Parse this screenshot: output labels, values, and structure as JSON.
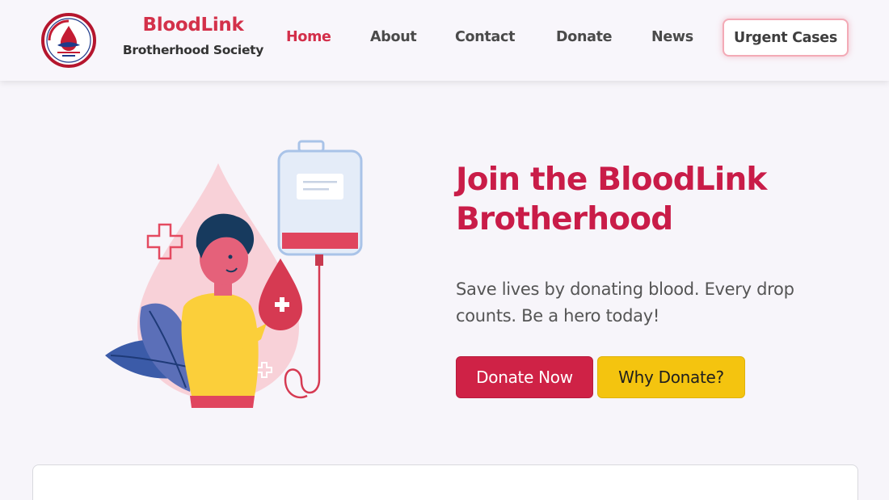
{
  "brand": {
    "name": "BloodLink",
    "subtitle": "Brotherhood Society"
  },
  "nav": {
    "items": [
      {
        "label": "Home",
        "active": true
      },
      {
        "label": "About",
        "active": false
      },
      {
        "label": "Contact",
        "active": false
      },
      {
        "label": "Donate",
        "active": false
      },
      {
        "label": "News",
        "active": false
      }
    ],
    "urgent_label": "Urgent Cases"
  },
  "hero": {
    "title": "Join the BloodLink Brotherhood",
    "text": "Save lives by donating blood. Every drop counts. Be a hero today!",
    "primary_button": "Donate Now",
    "secondary_button": "Why Donate?"
  },
  "icons": {
    "logo": "blood-drop-logo-icon",
    "illustration": "blood-donation-illustration"
  },
  "colors": {
    "brand_red": "#d3314a",
    "hero_title": "#c91c48",
    "primary_button": "#cf2246",
    "secondary_button": "#f4c40f",
    "background": "#f7f5fa"
  }
}
